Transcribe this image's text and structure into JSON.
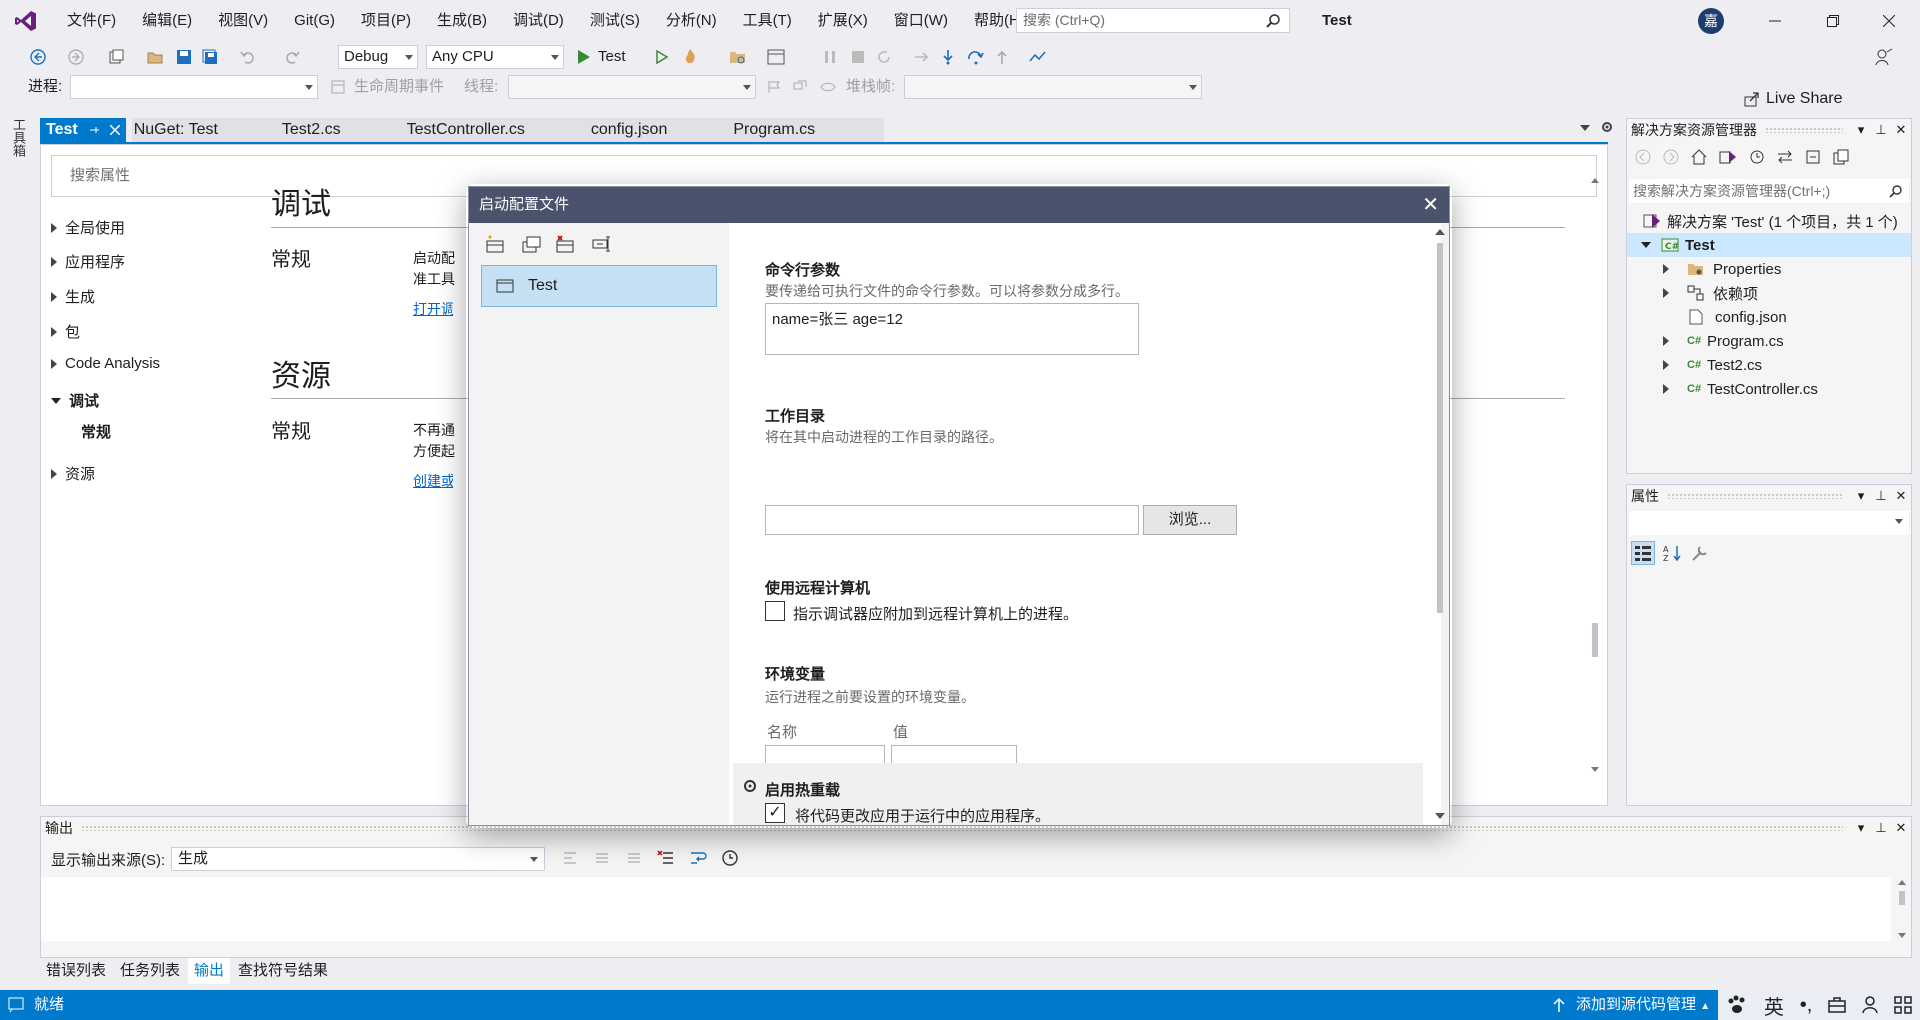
{
  "window": {
    "menu": [
      "文件(F)",
      "编辑(E)",
      "视图(V)",
      "Git(G)",
      "项目(P)",
      "生成(B)",
      "调试(D)",
      "测试(S)",
      "分析(N)",
      "工具(T)",
      "扩展(X)",
      "窗口(W)",
      "帮助(H)"
    ],
    "search_placeholder": "搜索 (Ctrl+Q)",
    "solution_name": "Test",
    "avatar_initial": "嘉",
    "live_share": "Live Share"
  },
  "toolbar": {
    "configuration": "Debug",
    "platform": "Any CPU",
    "run_target": "Test",
    "process_label": "进程:",
    "lifecycle_label": "生命周期事件",
    "thread_label": "线程:",
    "stack_label": "堆栈帧:"
  },
  "toolbox_label": "工具箱",
  "doc_tabs": {
    "active": "Test",
    "others": [
      "NuGet: Test",
      "Test2.cs",
      "TestController.cs",
      "config.json",
      "Program.cs"
    ]
  },
  "project_props": {
    "search_placeholder": "搜索属性",
    "nav": [
      "全局使用",
      "应用程序",
      "生成",
      "包",
      "Code Analysis",
      "调试",
      "常规",
      "资源"
    ],
    "debug_section": "调试",
    "general": "常规",
    "debug_text_line1": "启动配",
    "debug_text_line2": "准工具",
    "debug_link": "打开调",
    "resources_section": "资源",
    "resources_text_line1": "不再通",
    "resources_text_line2": "方便起",
    "resources_link": "创建或"
  },
  "solution_explorer": {
    "title": "解决方案资源管理器",
    "search_placeholder": "搜索解决方案资源管理器(Ctrl+;)",
    "solution_node": "解决方案 'Test' (1 个项目，共 1 个)",
    "project_node": "Test",
    "items": [
      "Properties",
      "依赖项",
      "config.json",
      "Program.cs",
      "Test2.cs",
      "TestController.cs"
    ]
  },
  "properties_panel": {
    "title": "属性"
  },
  "output_panel": {
    "title": "输出",
    "source_label": "显示输出来源(S):",
    "source_value": "生成"
  },
  "bottom_tabs": [
    "错误列表",
    "任务列表",
    "输出",
    "查找符号结果"
  ],
  "statusbar": {
    "ready": "就绪",
    "source_control": "添加到源代码管理",
    "ime": "英"
  },
  "dialog": {
    "title": "启动配置文件",
    "profile": "Test",
    "cmd_title": "命令行参数",
    "cmd_desc": "要传递给可执行文件的命令行参数。可以将参数分成多行。",
    "cmd_value": "name=张三 age=12",
    "workdir_title": "工作目录",
    "workdir_desc": "将在其中启动进程的工作目录的路径。",
    "workdir_value": "",
    "browse": "浏览...",
    "remote_title": "使用远程计算机",
    "remote_check": "指示调试器应附加到远程计算机上的进程。",
    "remote_checked": false,
    "env_title": "环境变量",
    "env_desc": "运行进程之前要设置的环境变量。",
    "env_name": "名称",
    "env_value": "值",
    "hot_reload_title": "启用热重载",
    "hot_reload_check": "将代码更改应用于运行中的应用程序。",
    "hot_reload_checked": true
  },
  "colors": {
    "accent": "#007acc",
    "dialog_title_bg": "#4b526b",
    "selection": "#c5e0f2"
  }
}
